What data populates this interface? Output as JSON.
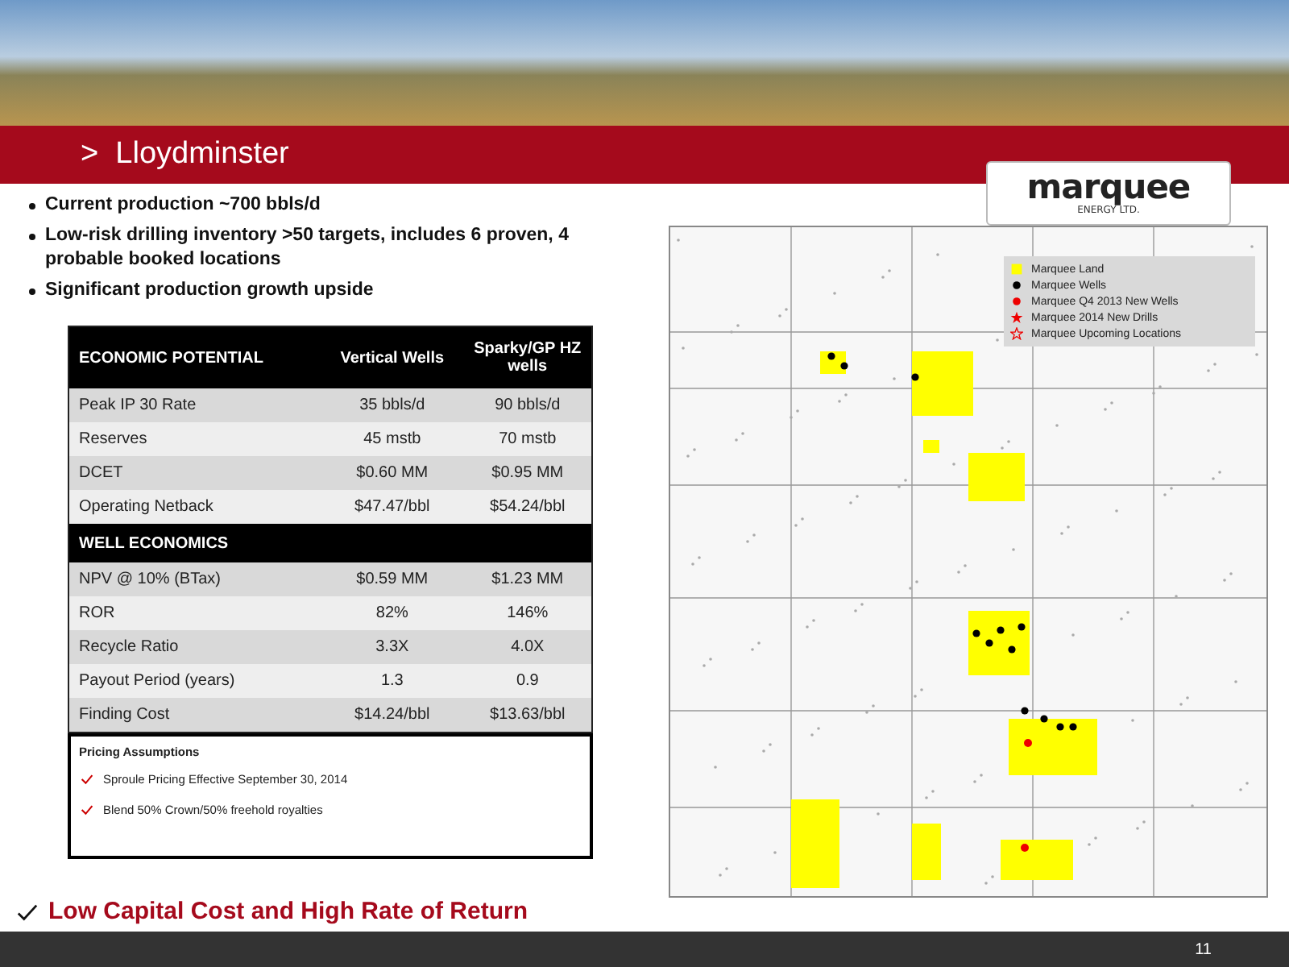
{
  "title": {
    "prefix": ">",
    "text": "Lloydminster"
  },
  "logo": {
    "name": "marquee",
    "subtitle": "ENERGY LTD."
  },
  "bullets": [
    "Current production ~700 bbls/d",
    "Low-risk drilling inventory >50 targets,  includes 6 proven, 4 probable booked locations",
    "Significant production growth upside"
  ],
  "table": {
    "rows": [
      {
        "kind": "header",
        "cells": [
          "ECONOMIC POTENTIAL",
          "Vertical Wells",
          "Sparky/GP HZ wells"
        ]
      },
      {
        "kind": "data",
        "cells": [
          "Peak IP 30 Rate",
          "35 bbls/d",
          "90 bbls/d"
        ]
      },
      {
        "kind": "data",
        "cells": [
          "Reserves",
          "45 mstb",
          "70 mstb"
        ]
      },
      {
        "kind": "data",
        "cells": [
          "DCET",
          "$0.60 MM",
          "$0.95 MM"
        ]
      },
      {
        "kind": "data",
        "cells": [
          "Operating Netback",
          "$47.47/bbl",
          "$54.24/bbl"
        ]
      },
      {
        "kind": "header",
        "cells": [
          "WELL ECONOMICS"
        ]
      },
      {
        "kind": "data",
        "cells": [
          "NPV @ 10% (BTax)",
          "$0.59 MM",
          "$1.23 MM"
        ]
      },
      {
        "kind": "data",
        "cells": [
          "ROR",
          "82%",
          "146%"
        ]
      },
      {
        "kind": "data",
        "cells": [
          "Recycle Ratio",
          "3.3X",
          "4.0X"
        ]
      },
      {
        "kind": "data",
        "cells": [
          "Payout Period  (years)",
          "1.3",
          "0.9"
        ]
      },
      {
        "kind": "data",
        "cells": [
          "Finding Cost",
          "$14.24/bbl",
          "$13.63/bbl"
        ]
      }
    ]
  },
  "pricing": {
    "title": "Pricing Assumptions",
    "items": [
      "Sproule Pricing Effective September 30, 2014",
      "Blend 50% Crown/50% freehold royalties"
    ]
  },
  "conclusion": "Low Capital Cost and High Rate of Return",
  "map": {
    "legend": [
      {
        "kind": "land",
        "label": "Marquee Land"
      },
      {
        "kind": "well",
        "label": "Marquee Wells"
      },
      {
        "kind": "new-well",
        "label": "Marquee Q4 2013 New Wells"
      },
      {
        "kind": "drill",
        "label": "Marquee 2014 New Drills"
      },
      {
        "kind": "upcoming",
        "label": "Marquee Upcoming Locations"
      }
    ]
  },
  "page_number": "11"
}
